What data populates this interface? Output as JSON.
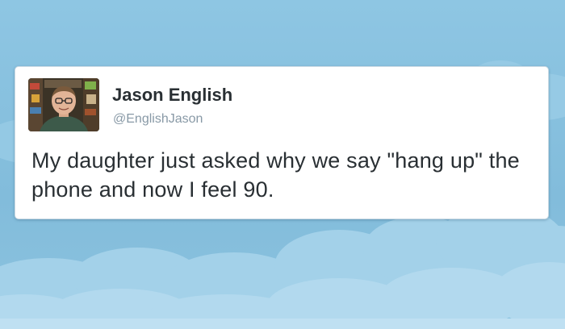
{
  "tweet": {
    "display_name": "Jason English",
    "handle": "@EnglishJason",
    "text": "My daughter just asked why we say \"hang up\" the phone and now I feel 90."
  },
  "icons": {
    "avatar": "profile-photo-man-with-glasses"
  },
  "colors": {
    "sky": "#86bfdd",
    "cloud": "#a8d3ea",
    "card": "#ffffff",
    "name": "#292f33",
    "handle": "#8899a6"
  }
}
